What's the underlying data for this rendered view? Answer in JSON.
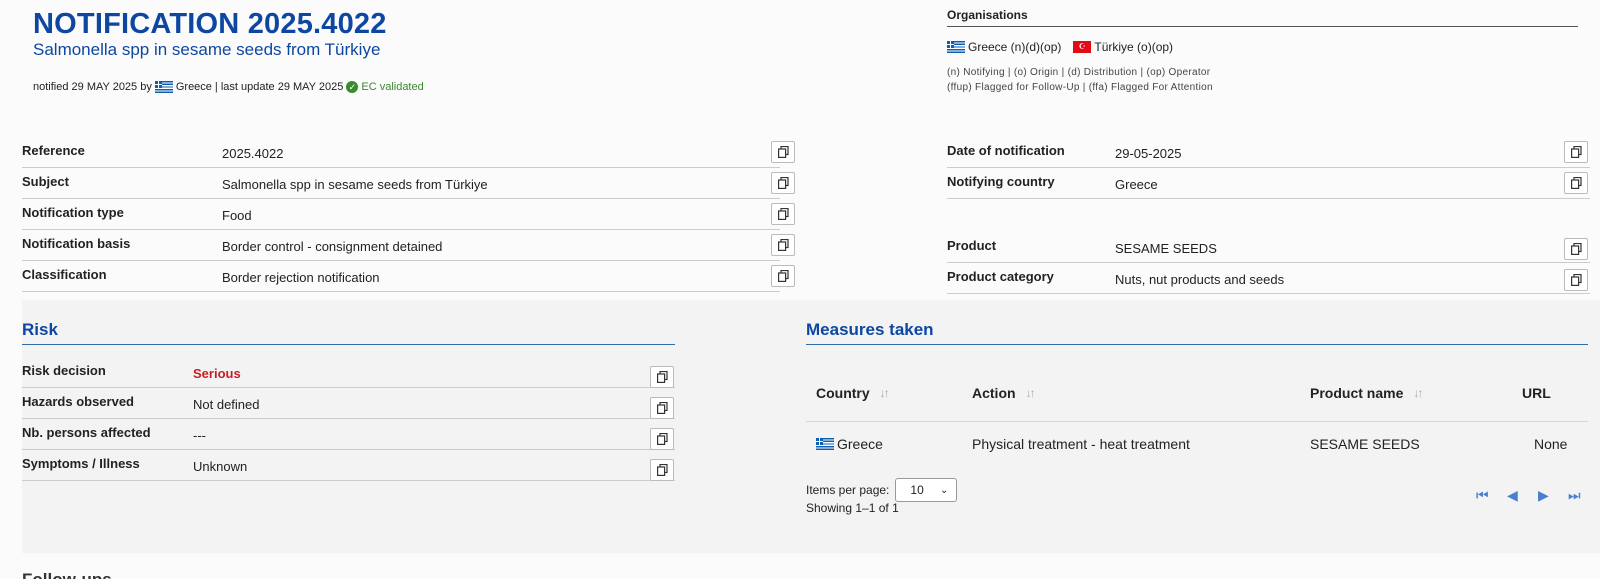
{
  "header": {
    "title": "NOTIFICATION 2025.4022",
    "subtitle": "Salmonella spp in sesame seeds from Türkiye",
    "notified_prefix": "notified 29 MAY 2025 by",
    "notified_country": "Greece",
    "last_update": "| last update 29 MAY 2025",
    "validated": "EC validated"
  },
  "organisations": {
    "title": "Organisations",
    "items": [
      {
        "flag": "greece-flag",
        "text": "Greece (n)(d)(op)"
      },
      {
        "flag": "turkiye-flag",
        "text": "Türkiye (o)(op)"
      }
    ],
    "legend1": "(n) Notifying | (o) Origin | (d) Distribution | (op) Operator",
    "legend2": "(ffup) Flagged for Follow-Up | (ffa) Flagged For Attention"
  },
  "details_left": [
    {
      "label": "Reference",
      "value": "2025.4022"
    },
    {
      "label": "Subject",
      "value": "Salmonella spp in sesame seeds from Türkiye"
    },
    {
      "label": "Notification type",
      "value": "Food"
    },
    {
      "label": "Notification basis",
      "value": "Border control - consignment detained"
    },
    {
      "label": "Classification",
      "value": "Border rejection notification"
    }
  ],
  "details_right": [
    {
      "label": "Date of notification",
      "value": "29-05-2025"
    },
    {
      "label": "Notifying country",
      "value": "Greece"
    },
    {
      "label": "Product",
      "value": "SESAME SEEDS"
    },
    {
      "label": "Product category",
      "value": "Nuts, nut products and seeds"
    }
  ],
  "risk": {
    "title": "Risk",
    "rows": [
      {
        "label": "Risk decision",
        "value": "Serious"
      },
      {
        "label": "Hazards observed",
        "value": "Not defined"
      },
      {
        "label": "Nb. persons affected",
        "value": "---"
      },
      {
        "label": "Symptoms / Illness",
        "value": "Unknown"
      }
    ]
  },
  "measures": {
    "title": "Measures taken",
    "columns": [
      "Country",
      "Action",
      "Product name",
      "URL"
    ],
    "rows": [
      {
        "country": "Greece",
        "action": "Physical treatment - heat treatment",
        "product": "SESAME SEEDS",
        "url": "None"
      }
    ],
    "items_per_page_label": "Items per page:",
    "items_per_page": "10",
    "showing": "Showing 1–1 of 1"
  },
  "followups_title": "Follow-ups",
  "colors": {
    "brand_blue": "#0e47a1",
    "serious_red": "#c41f24",
    "validated_green": "#3a8a2e"
  }
}
